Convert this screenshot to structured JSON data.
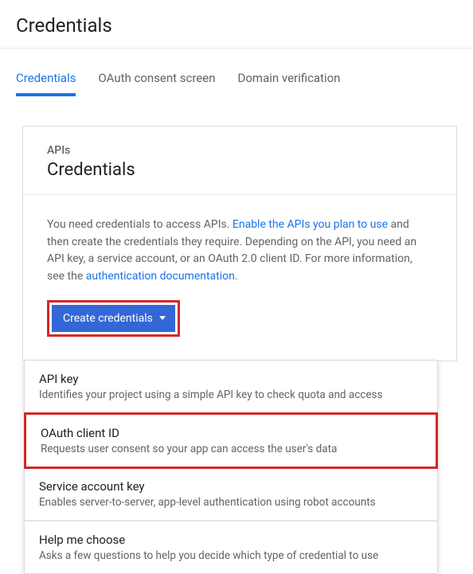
{
  "page": {
    "title": "Credentials"
  },
  "tabs": {
    "items": [
      {
        "label": "Credentials",
        "active": true
      },
      {
        "label": "OAuth consent screen",
        "active": false
      },
      {
        "label": "Domain verification",
        "active": false
      }
    ]
  },
  "card": {
    "eyebrow": "APIs",
    "title": "Credentials",
    "info_pre": "You need credentials to access APIs. ",
    "link1": "Enable the APIs you plan to use",
    "info_mid": " and then create the credentials they require. Depending on the API, you need an API key, a service account, or an OAuth 2.0 client ID. For more information, see the ",
    "link2": "authentication documentation",
    "info_post": ".",
    "button_label": "Create credentials"
  },
  "dropdown": {
    "items": [
      {
        "title": "API key",
        "desc": "Identifies your project using a simple API key to check quota and access",
        "highlighted": false
      },
      {
        "title": "OAuth client ID",
        "desc": "Requests user consent so your app can access the user's data",
        "highlighted": true
      },
      {
        "title": "Service account key",
        "desc": "Enables server-to-server, app-level authentication using robot accounts",
        "highlighted": false
      },
      {
        "title": "Help me choose",
        "desc": "Asks a few questions to help you decide which type of credential to use",
        "highlighted": false,
        "separated": true
      }
    ]
  },
  "highlight_color": "#d62727",
  "accent_color": "#1a73e8"
}
